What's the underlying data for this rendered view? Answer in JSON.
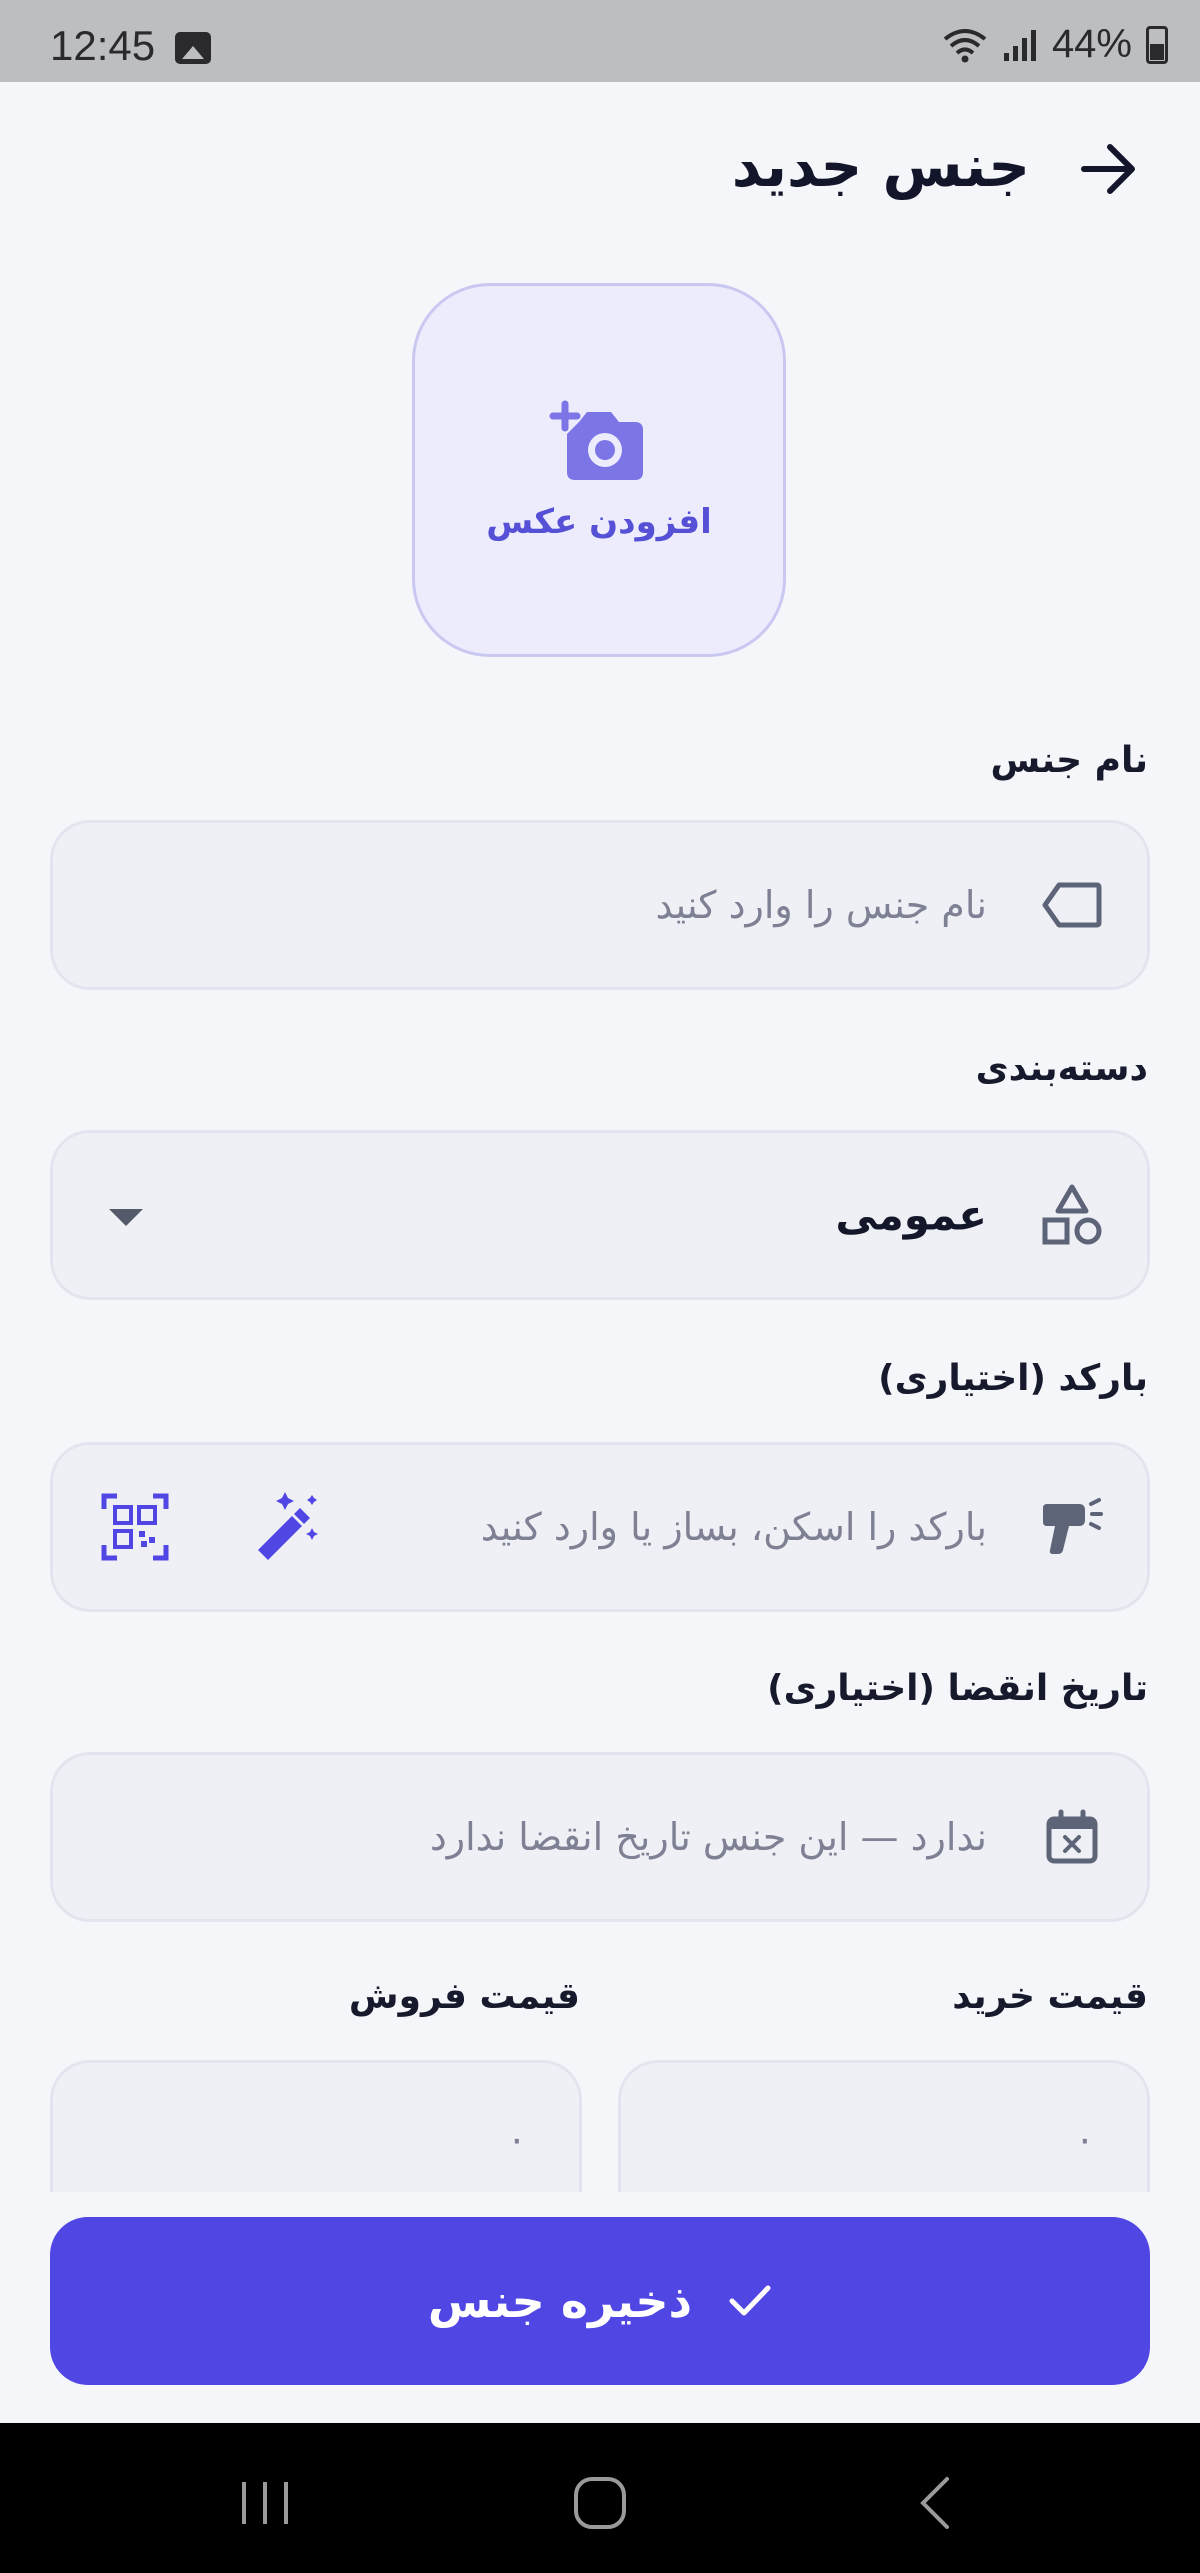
{
  "status_bar": {
    "time": "12:45",
    "battery": "44%"
  },
  "header": {
    "title": "جنس جدید",
    "back_icon": "arrow-right-icon"
  },
  "photo": {
    "label": "افزودن عکس",
    "icon": "add-camera-icon"
  },
  "fields": {
    "name": {
      "label": "نام جنس",
      "placeholder": "نام جنس را وارد کنید",
      "icon": "tag-icon"
    },
    "category": {
      "label": "دسته‌بندی",
      "value": "عمومی",
      "icon": "shapes-icon"
    },
    "barcode": {
      "label": "بارکد (اختیاری)",
      "placeholder": "بارکد را اسکن، بساز یا وارد کنید",
      "icon": "barcode-scanner-icon"
    },
    "expiry": {
      "label": "تاریخ انقضا (اختیاری)",
      "placeholder": "ندارد — این جنس تاریخ انقضا ندارد",
      "icon": "calendar-x-icon"
    },
    "purchase_price": {
      "label": "قیمت خرید",
      "value": "۰"
    },
    "sale_price": {
      "label": "قیمت فروش",
      "value": "۰"
    }
  },
  "save_button": {
    "label": "ذخیره جنس",
    "icon": "check-icon"
  },
  "colors": {
    "accent": "#5046e4",
    "field_bg": "#eff0f6",
    "photo_bg": "#ececfd"
  }
}
